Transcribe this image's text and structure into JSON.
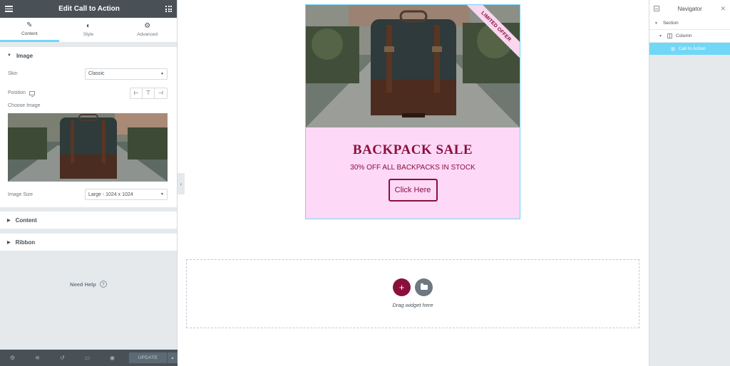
{
  "panel": {
    "title": "Edit Call to Action",
    "tabs": [
      {
        "label": "Content",
        "icon": "pencil-icon"
      },
      {
        "label": "Style",
        "icon": "half-circle-icon"
      },
      {
        "label": "Advanced",
        "icon": "gear-icon"
      }
    ],
    "sections": {
      "image": "Image",
      "content": "Content",
      "ribbon": "Ribbon"
    },
    "controls": {
      "skin_label": "Skin",
      "skin_value": "Classic",
      "position_label": "Position",
      "choose_image_label": "Choose Image",
      "image_size_label": "Image Size",
      "image_size_value": "Large - 1024 x 1024"
    },
    "need_help": "Need Help",
    "footer": {
      "update_label": "UPDATE"
    }
  },
  "canvas": {
    "cta": {
      "ribbon": "LIMITED OFFER",
      "title": "BACKPACK SALE",
      "description": "30% OFF ALL BACKPACKS IN STOCK",
      "button": "Click Here"
    },
    "dropzone": {
      "text": "Drag widget here"
    }
  },
  "navigator": {
    "title": "Navigator",
    "items": [
      {
        "label": "Section"
      },
      {
        "label": "Column"
      },
      {
        "label": "Call to Action"
      }
    ]
  },
  "colors": {
    "accent": "#71d7f7",
    "brand": "#8a0f3c",
    "cta_bg": "#fdd8f7",
    "panel_dark": "#495157"
  }
}
